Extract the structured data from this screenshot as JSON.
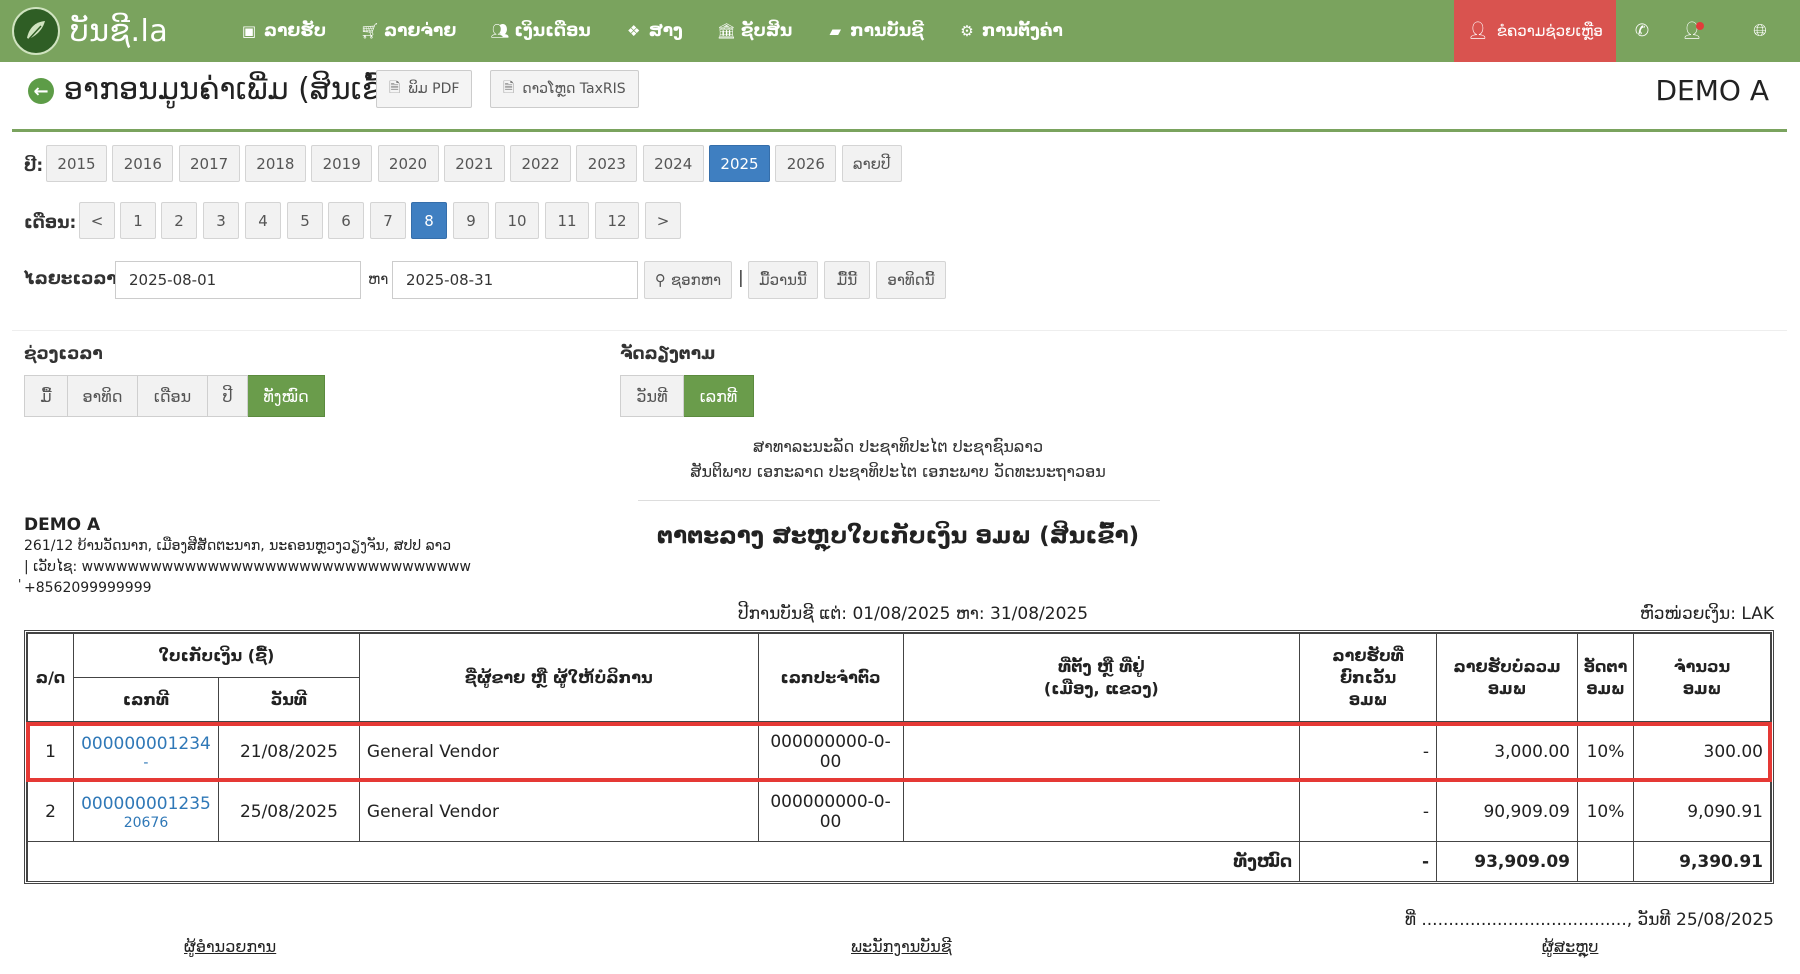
{
  "app": {
    "logo_text": "ບັນຊີ.la"
  },
  "nav": {
    "items": [
      {
        "label": "ລາຍຮັບ",
        "icon": "money-icon"
      },
      {
        "label": "ລາຍຈ່າຍ",
        "icon": "cart-icon"
      },
      {
        "label": "ເງິນເດືອນ",
        "icon": "users-icon"
      },
      {
        "label": "ສາງ",
        "icon": "box-icon"
      },
      {
        "label": "ຊັບສິນ",
        "icon": "bank-icon"
      },
      {
        "label": "ການບັນຊີ",
        "icon": "book-icon"
      },
      {
        "label": "ການຕັ້ງຄ່າ",
        "icon": "cogs-icon"
      }
    ],
    "help_label": "ຂໍຄວາມຊ່ວຍເຫຼືອ"
  },
  "titlebar": {
    "title": "ອາກອນມູນຄ່າເພີ່ມ (ສິນເຂົ້າ)",
    "print_pdf": "ພິມ PDF",
    "download_taxris": "ດາວໂຫຼດ TaxRIS",
    "company": "DEMO A"
  },
  "filters": {
    "year_label": "ປີ:",
    "years": [
      "2015",
      "2016",
      "2017",
      "2018",
      "2019",
      "2020",
      "2021",
      "2022",
      "2023",
      "2024",
      "2025",
      "2026",
      "ລາຍປີ"
    ],
    "active_year": "2025",
    "month_label": "ເດືອນ:",
    "months": [
      "<",
      "1",
      "2",
      "3",
      "4",
      "5",
      "6",
      "7",
      "8",
      "9",
      "10",
      "11",
      "12",
      ">"
    ],
    "active_month": "8",
    "period_label": "ໄລຍະເວລາ:",
    "date_from": "2025-08-01",
    "to_label": "ຫາ",
    "date_to": "2025-08-31",
    "search_label": "ຊອກຫາ",
    "divider": "|",
    "today_label": "ມື້ວານນີ້",
    "day_label": "ມື້ນີ້",
    "week_label": "ອາທິດນີ້",
    "range_title": "ຊ່ວງເວລາ",
    "ranges": [
      "ມື້",
      "ອາທິດ",
      "ເດືອນ",
      "ປີ",
      "ທັງໝົດ"
    ],
    "active_range": "ທັງໝົດ",
    "sort_title": "ຈັດລຽງຕາມ",
    "sorts": [
      "ວັນທີ",
      "ເລກທີ"
    ],
    "active_sort": "ເລກທີ"
  },
  "report": {
    "line1": "ສາທາລະນະລັດ ປະຊາທິປະໄຕ ປະຊາຊົນລາວ",
    "line2": "ສັນຕິພາບ ເອກະລາດ ປະຊາທິປະໄຕ ເອກະພາບ ວັດທະນະຖາວອນ",
    "title": "ຕາຕະລາງ ສະຫຼຸບໃບເກັບເງິນ ອມພ (ສິນເຂົ້າ)",
    "company_name": "DEMO A",
    "company_address": "261/12 ບ້ານວັດນາກ, ເມືອງສີສັດຕະນາກ, ນະຄອນຫຼວງວຽງຈັນ, ສປປ ລາວ",
    "company_web": "| ເວັບໄຊ: wwwwwwwwwwwwwwwwwwwwwwwwwwwwwwwwww",
    "company_phone": "+8562099999999",
    "company_mark": "'",
    "period": "ປີການບັນຊີ ແຕ່: 01/08/2025 ຫາ: 31/08/2025",
    "currency": "ຫົວໜ່ວຍເງິນ: LAK"
  },
  "table": {
    "headers": {
      "no": "ລ/ດ",
      "invoice": "ໃບເກັບເງິນ (ຊື້)",
      "number": "ເລກທີ",
      "date": "ວັນທີ",
      "vendor": "ຊື່ຜູ້ຂາຍ ຫຼື ຜູ້ໃຫ້ບໍລິການ",
      "tax_id": "ເລກປະຈຳຕົວ",
      "address_1": "ທີ່ຕັ້ງ ຫຼື ທີ່ຢູ່",
      "address_2": "(ເມືອງ, ແຂວງ)",
      "exempt_1": "ລາຍຮັບທີ່",
      "exempt_2": "ຍົກເວັ້ນ",
      "exempt_3": "ອມພ",
      "base_1": "ລາຍຮັບບໍ່ລວມ",
      "base_2": "ອມພ",
      "rate_1": "ອັດຕາ",
      "rate_2": "ອມພ",
      "vat_1": "ຈຳນວນ",
      "vat_2": "ອມພ"
    },
    "rows": [
      {
        "no": "1",
        "number": "000000001234",
        "sub": "-",
        "date": "21/08/2025",
        "vendor": "General Vendor",
        "tax_id": "000000000-0-00",
        "address": "",
        "exempt": "-",
        "base": "3,000.00",
        "rate": "10%",
        "vat": "300.00"
      },
      {
        "no": "2",
        "number": "000000001235",
        "sub": "20676",
        "date": "25/08/2025",
        "vendor": "General Vendor",
        "tax_id": "000000000-0-00",
        "address": "",
        "exempt": "-",
        "base": "90,909.09",
        "rate": "10%",
        "vat": "9,090.91"
      }
    ],
    "total": {
      "label": "ທັງໝົດ",
      "exempt": "-",
      "base": "93,909.09",
      "vat": "9,390.91"
    }
  },
  "footer": {
    "date_line": "ທີ່ ......................................, ວັນທີ 25/08/2025",
    "sig_director": "ຜູ້ອຳນວຍການ",
    "sig_accountant": "ພະນັກງານບັນຊີ",
    "sig_preparer": "ຜູ້ສະຫຼຸບ"
  },
  "colors": {
    "nav_green": "#7aa35e",
    "active_blue": "#3f7fc1",
    "active_green": "#6a9c4b",
    "help_red": "#d9534f",
    "link_blue": "#2f78b7",
    "highlight_red": "#e53935"
  }
}
